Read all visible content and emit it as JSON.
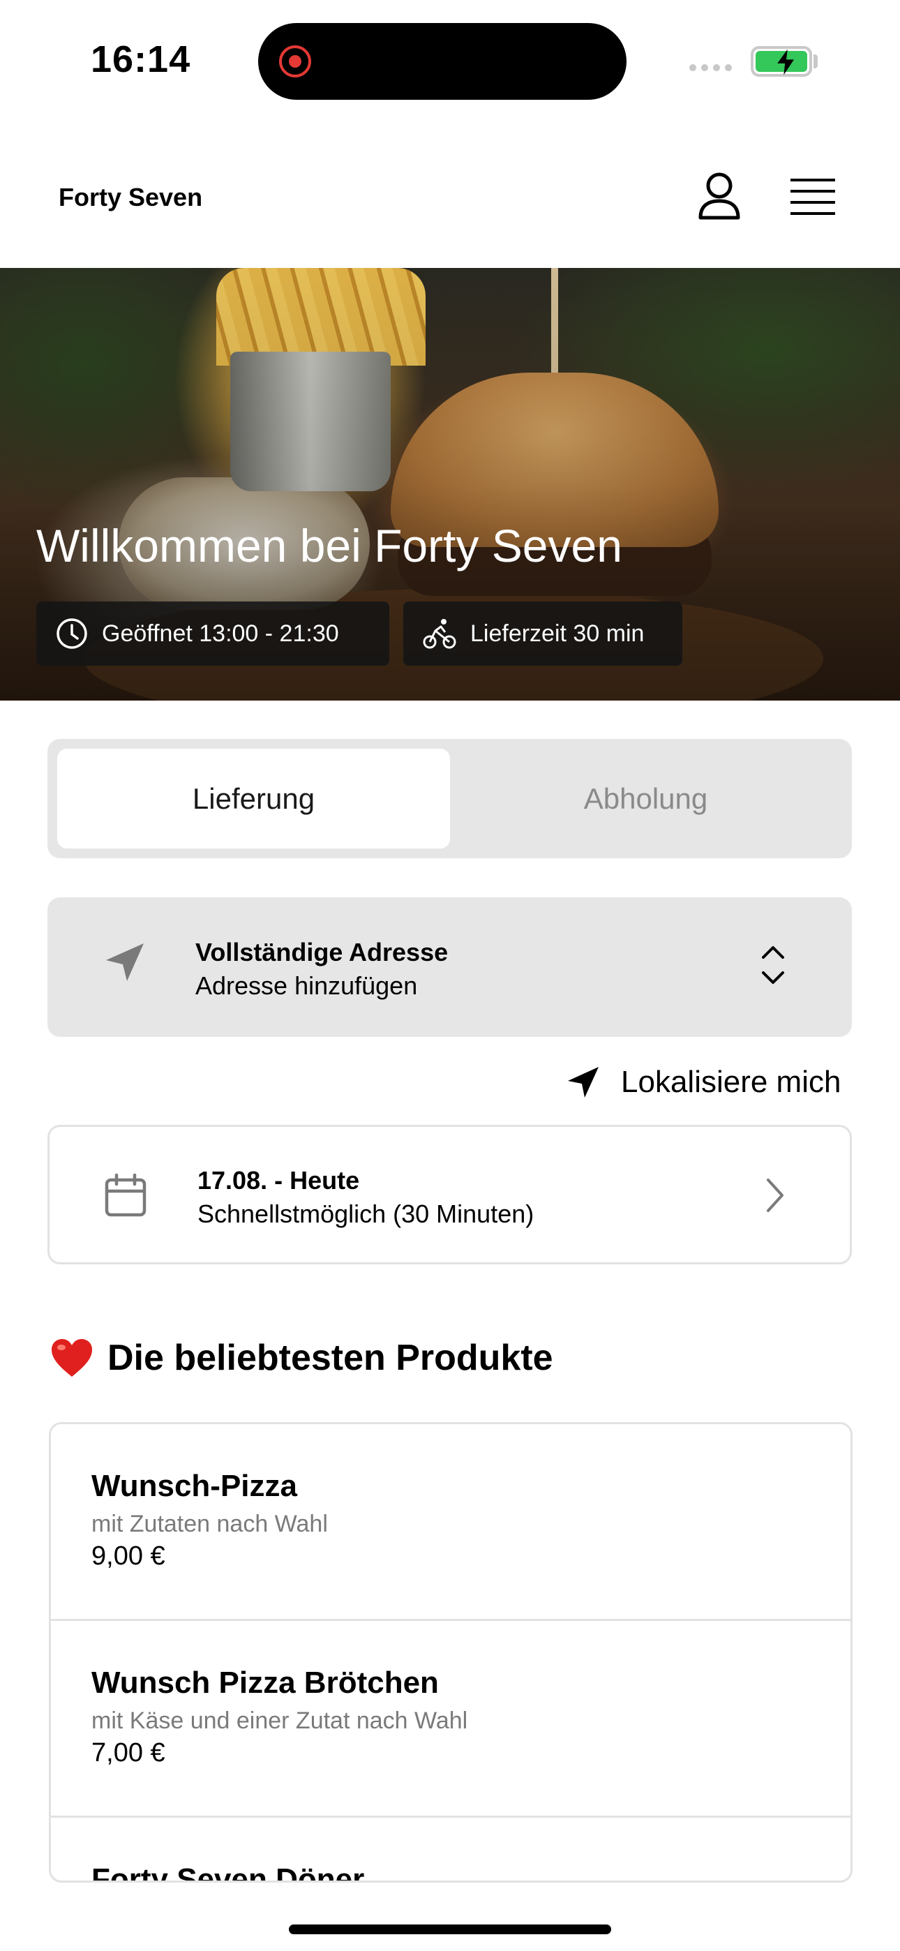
{
  "status_bar": {
    "time": "16:14"
  },
  "header": {
    "brand": "Forty Seven"
  },
  "hero": {
    "title": "Willkommen bei Forty Seven",
    "open_hours": "Geöffnet 13:00 - 21:30",
    "delivery_time": "Lieferzeit 30 min"
  },
  "order_mode": {
    "options": [
      "Lieferung",
      "Abholung"
    ],
    "selected": "Lieferung"
  },
  "address": {
    "title": "Vollständige Adresse",
    "subtitle": "Adresse hinzufügen"
  },
  "locate_label": "Lokalisiere mich",
  "schedule": {
    "title": "17.08. - Heute",
    "subtitle": "Schnellstmöglich (30 Minuten)"
  },
  "popular": {
    "heading": "Die beliebtesten Produkte",
    "heading_emoji": "❤️",
    "items": [
      {
        "name": "Wunsch-Pizza",
        "description": "mit Zutaten nach Wahl",
        "price": "9,00 €"
      },
      {
        "name": "Wunsch Pizza Brötchen",
        "description": "mit Käse und einer Zutat nach Wahl",
        "price": "7,00 €"
      },
      {
        "name": "Forty Seven Döner",
        "description": "",
        "price": ""
      }
    ]
  },
  "colors": {
    "accent_green": "#34c759",
    "record_red": "#e53935",
    "panel_grey": "#e6e6e6"
  },
  "icons": [
    "user-icon",
    "menu-icon",
    "clock-icon",
    "bike-icon",
    "location-arrow-icon",
    "chevron-up-down-icon",
    "calendar-icon",
    "chevron-right-icon",
    "heart-icon"
  ]
}
